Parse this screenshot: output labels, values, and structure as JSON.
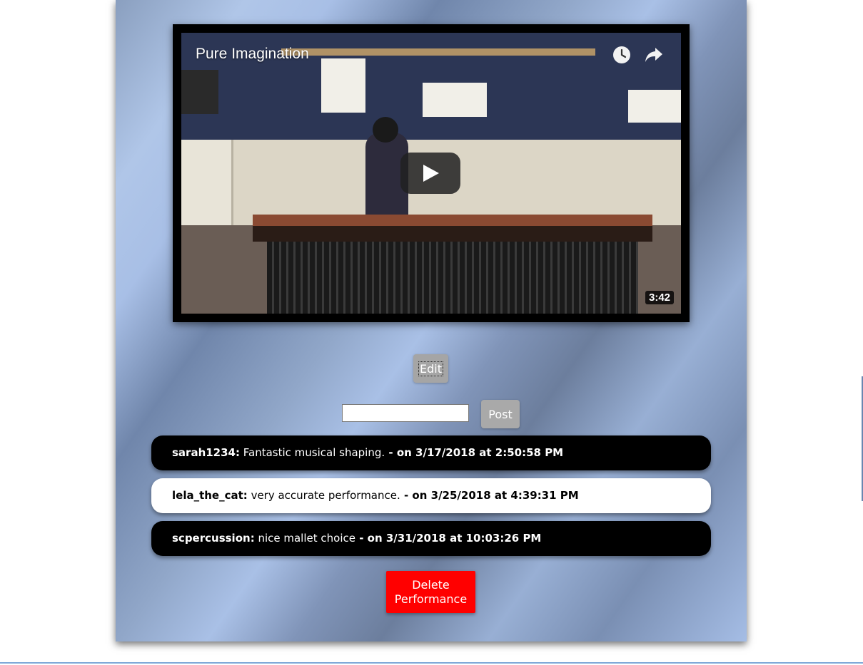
{
  "video": {
    "title": "Pure Imagination",
    "duration": "3:42",
    "icons": [
      "clock-icon",
      "share-icon",
      "play-icon"
    ]
  },
  "actions": {
    "edit_label": "Edit",
    "post_label": "Post",
    "comment_placeholder": "",
    "delete_label": "Delete Performance"
  },
  "comments": [
    {
      "user": "sarah1234",
      "sep": ":",
      "text": " Fantastic musical shaping.",
      "stamp": " - on 3/17/2018 at 2:50:58 PM"
    },
    {
      "user": "lela_the_cat",
      "sep": ":",
      "text": " very accurate performance.",
      "stamp": " - on 3/25/2018 at 4:39:31 PM"
    },
    {
      "user": "scpercussion",
      "sep": ":",
      "text": " nice mallet choice",
      "stamp": " - on 3/31/2018 at 10:03:26 PM"
    }
  ],
  "colors": {
    "delete": "#ff0000",
    "button_gray": "#a5a5a5",
    "comment_dark": "#000000",
    "comment_light": "#ffffff"
  }
}
